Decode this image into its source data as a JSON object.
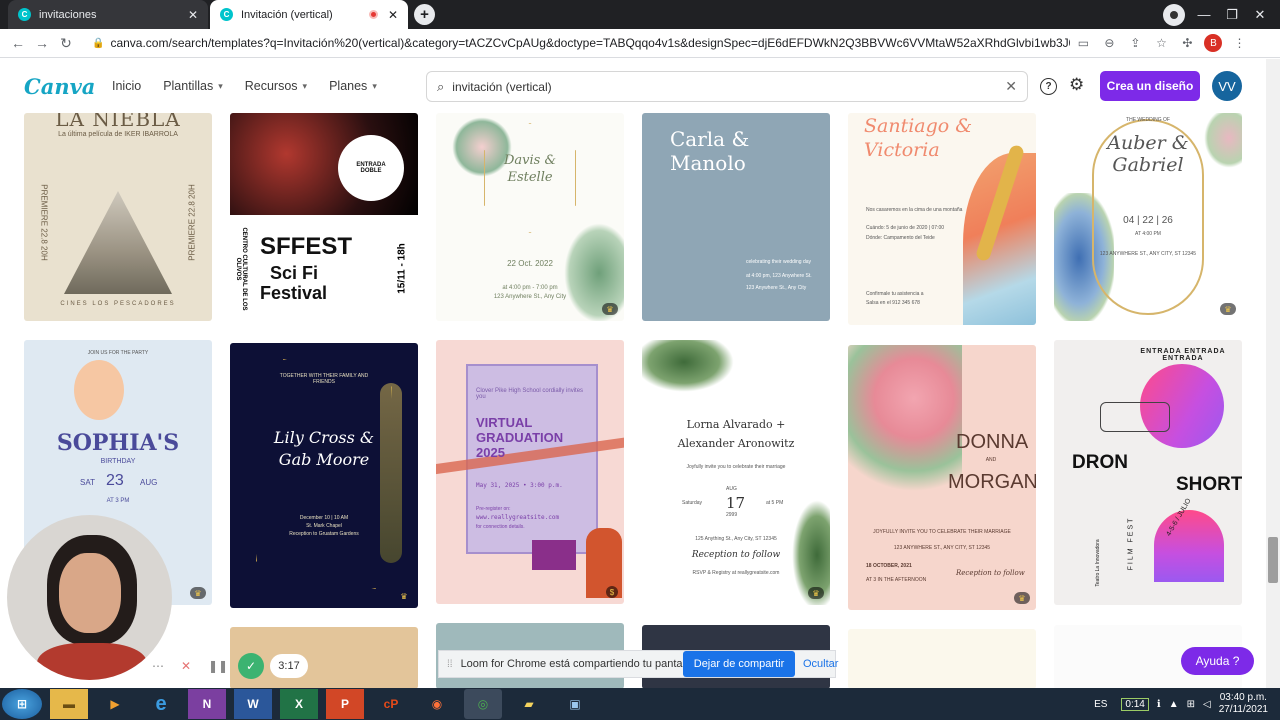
{
  "browser": {
    "tabs": [
      {
        "label": "invitaciones"
      },
      {
        "label": "Invitación (vertical)"
      }
    ],
    "url": "canva.com/search/templates?q=Invitación%20(vertical)&category=tACZCvCpAUg&doctype=TABQqqo4v1s&designSpec=djE6dEFDWkN2Q3BBVWc6VVMtaW52aXRhdGlvbi1wb3J0cmFp...",
    "profile_initial": "B"
  },
  "header": {
    "logo": "Canva",
    "nav": [
      {
        "label": "Inicio"
      },
      {
        "label": "Plantillas"
      },
      {
        "label": "Recursos"
      },
      {
        "label": "Planes"
      }
    ],
    "search_value": "invitación (vertical)",
    "help": "?",
    "create_label": "Crea un diseño",
    "user_initials": "VV"
  },
  "templates": {
    "row1": [
      {
        "title": "LA NIEBLA",
        "sub": "La última película de IKER IBARROLA",
        "left": "PREMIERE 22.8 20H",
        "right": "PREMIERE 22.8 20H",
        "footer": "CINES LOS PESCADORES"
      },
      {
        "stamp": "ENTRADA DOBLE",
        "side": "CENTRO CULTURAL DE LOS OLIVOS",
        "title": "SFFEST",
        "sub1": "Sci Fi",
        "sub2": "Festival",
        "date": "15/11 - 18h"
      },
      {
        "names": "Davis & Estelle",
        "date": "22 Oct. 2022",
        "time": "at 4:00 pm - 7:00 pm",
        "addr": "123 Anywhere St., Any City"
      },
      {
        "names": "Carla & Manolo",
        "line1": "celebrating their wedding day",
        "line2": "at 4:00 pm, 123 Anywhere St.",
        "line3": "123 Anywhere St., Any City"
      },
      {
        "names": "Santiago & Victoria",
        "line1": "Nos casaremos en la cima de una montaña",
        "line2": "Cuándo: 5 de junio de 2020 | 07:00",
        "line3": "Dónde: Campamento del Teide",
        "line4": "Confirmale tu asistencia a",
        "line5": "Salsa en el 912 345 678"
      },
      {
        "pre": "THE WEDDING OF",
        "names": "Auber & Gabriel",
        "date": "04 | 22 | 26",
        "time": "AT 4:00 PM",
        "addr": "123 ANYWHERE ST., ANY CITY, ST 12345"
      }
    ],
    "row2": [
      {
        "pre": "JOIN US FOR THE PARTY",
        "name": "SOPHIA'S",
        "sub": "BIRTHDAY",
        "day": "SAT",
        "num": "23",
        "month": "AUG",
        "time": "AT 3 PM"
      },
      {
        "pre": "TOGETHER WITH THEIR FAMILY AND FRIENDS",
        "names": "Lily Cross & Gab Moore",
        "date": "December 10 | 10 AM",
        "place": "St. Mark Chapel",
        "rec": "Reception to Gruatam Gardens"
      },
      {
        "pre": "Clover Pike High School cordially invites you",
        "title": "VIRTUAL GRADUATION 2025",
        "date": "May 31, 2025 • 3:00 p.m.",
        "reg": "Pre-register on:",
        "site": "www.reallygreatsite.com",
        "note": "for connection details."
      },
      {
        "names": "Lorna Alvarado + Alexander Aronowitz",
        "invite": "Joyfully invite you to celebrate their marriage",
        "day": "Saturday",
        "month": "AUG",
        "num": "17",
        "year": "2999",
        "time": "at 5 PM",
        "addr": "125 Anything St., Any City, ST 12345",
        "rec": "Reception to follow",
        "rsvp": "RSVP & Registry at reallygreatsite.com"
      },
      {
        "n1": "DONNA",
        "and": "AND",
        "n2": "MORGAN",
        "inv": "JOYFULLY INVITE YOU TO CELEBRATE THEIR MARRIAGE",
        "addr": "123 ANYWHERE ST., ANY CITY, ST 12345",
        "date": "18 OCTOBER, 2021",
        "time": "AT 3 IN THE AFTERNOON",
        "rec": "Reception to follow"
      },
      {
        "arc": "ENTRADA ENTRADA ENTRADA",
        "t1": "DRON",
        "t2": "SHORT",
        "side": "FILM FEST",
        "date": "4-5-6 / JULIO",
        "theatre": "Teatro La Innovadora"
      }
    ]
  },
  "loom": {
    "text": "Loom for Chrome está compartiendo tu pantalla.",
    "stop": "Dejar de compartir",
    "hide": "Ocultar",
    "timer": "3:17"
  },
  "help_button": "Ayuda ?",
  "taskbar": {
    "lang": "ES",
    "battery": "0:14",
    "time": "03:40 p.m.",
    "date": "27/11/2021"
  },
  "colors": {
    "canva_purple": "#7d2ae8",
    "canva_teal": "#16a5c4",
    "loom_blue": "#1a73e8"
  }
}
